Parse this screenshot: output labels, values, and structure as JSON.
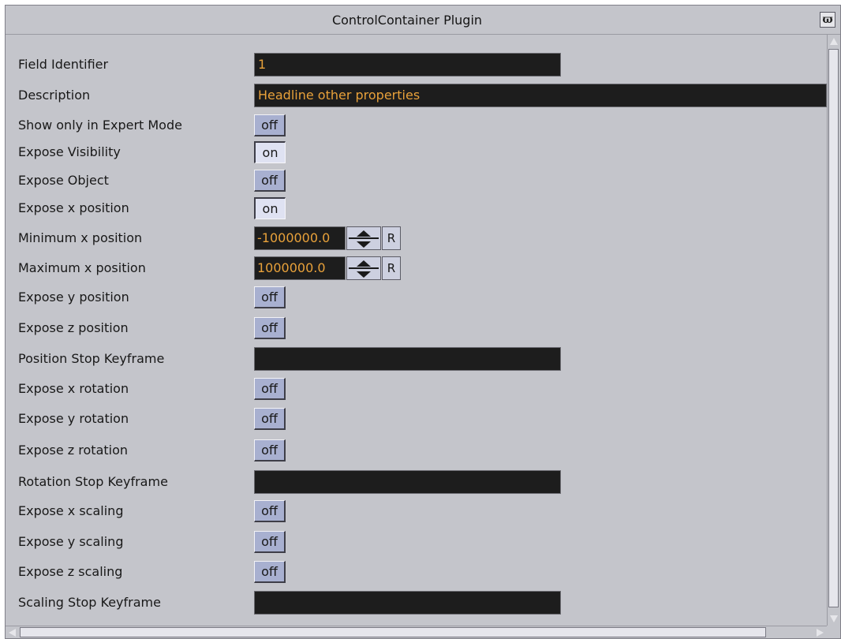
{
  "window": {
    "title": "ControlContainer Plugin",
    "close_icon": "window-close-icon"
  },
  "colors": {
    "panel_bg": "#c4c5cb",
    "field_bg": "#1d1d1d",
    "field_text": "#e8a13a",
    "toggle_bg": "#a8b0d0"
  },
  "fields": {
    "field_identifier": {
      "label": "Field Identifier",
      "value": "1"
    },
    "description": {
      "label": "Description",
      "value": "Headline other properties"
    },
    "show_only_expert": {
      "label": "Show only in Expert Mode",
      "value": "off"
    },
    "expose_visibility": {
      "label": "Expose Visibility",
      "value": "on"
    },
    "expose_object": {
      "label": "Expose Object",
      "value": "off"
    },
    "expose_x_position": {
      "label": "Expose x position",
      "value": "on"
    },
    "min_x_position": {
      "label": "Minimum x position",
      "value": "-1000000.0",
      "reset": "R"
    },
    "max_x_position": {
      "label": "Maximum x position",
      "value": "1000000.0",
      "reset": "R"
    },
    "expose_y_position": {
      "label": "Expose y position",
      "value": "off"
    },
    "expose_z_position": {
      "label": "Expose z position",
      "value": "off"
    },
    "position_stop_keyframe": {
      "label": "Position Stop Keyframe",
      "value": ""
    },
    "expose_x_rotation": {
      "label": "Expose x rotation",
      "value": "off"
    },
    "expose_y_rotation": {
      "label": "Expose y rotation",
      "value": "off"
    },
    "expose_z_rotation": {
      "label": "Expose z rotation",
      "value": "off"
    },
    "rotation_stop_keyframe": {
      "label": "Rotation Stop Keyframe",
      "value": ""
    },
    "expose_x_scaling": {
      "label": "Expose x scaling",
      "value": "off"
    },
    "expose_y_scaling": {
      "label": "Expose y scaling",
      "value": "off"
    },
    "expose_z_scaling": {
      "label": "Expose z scaling",
      "value": "off"
    },
    "scaling_stop_keyframe": {
      "label": "Scaling Stop Keyframe",
      "value": ""
    }
  }
}
